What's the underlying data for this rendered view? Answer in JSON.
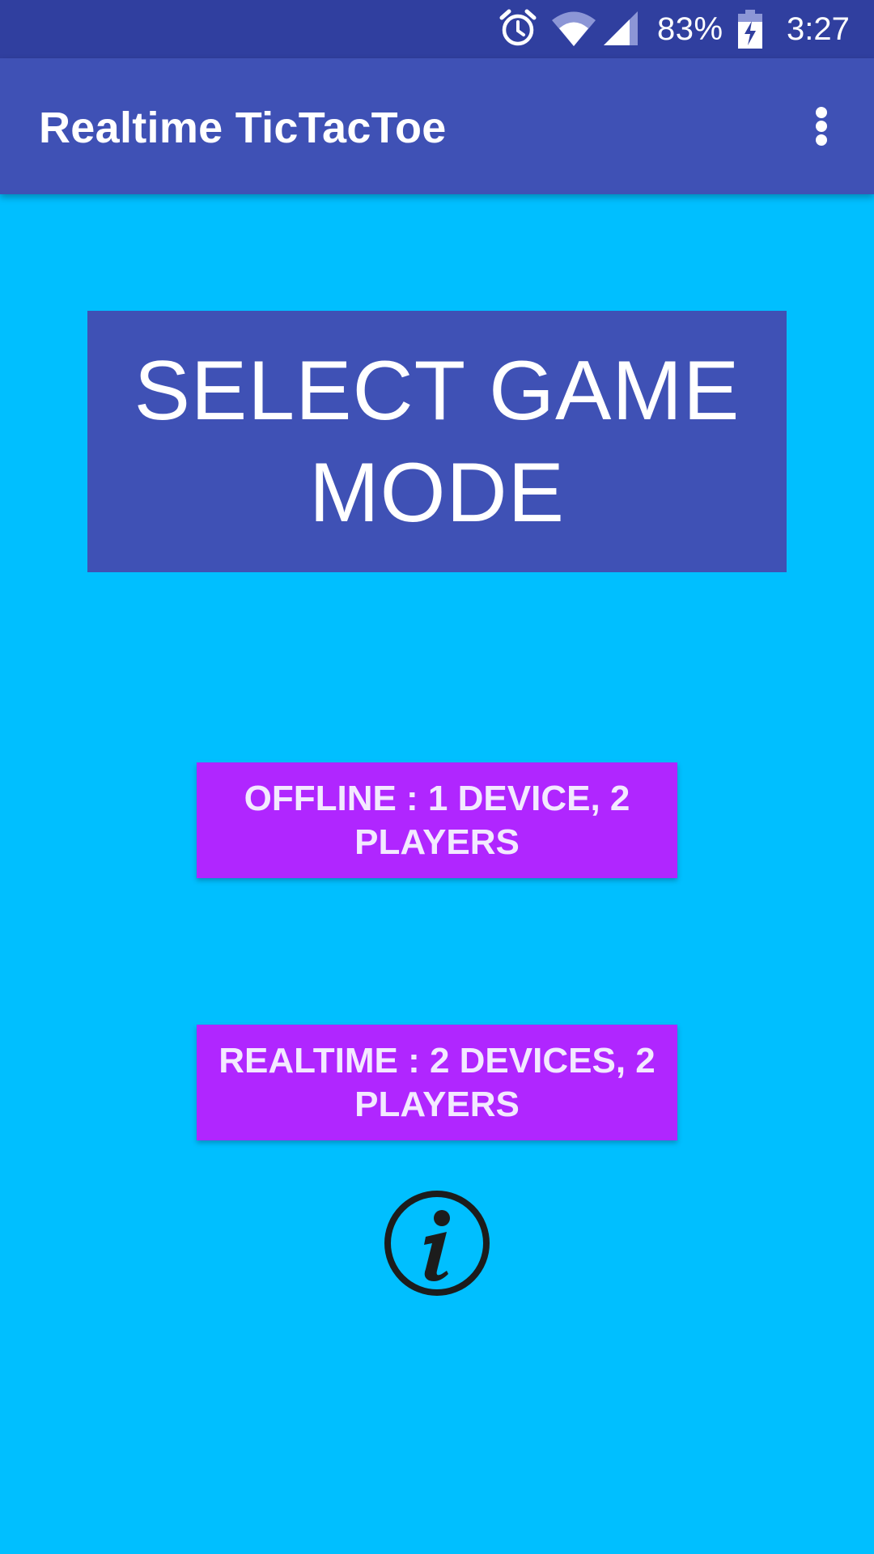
{
  "status_bar": {
    "battery_percent": "83%",
    "time": "3:27",
    "icons": [
      "alarm-icon",
      "wifi-icon",
      "cell-signal-icon",
      "battery-charging-icon"
    ]
  },
  "app_bar": {
    "title": "Realtime TicTacToe",
    "overflow_icon": "more-vert-icon"
  },
  "main": {
    "heading": "SELECT GAME MODE",
    "offline_button": "OFFLINE : 1 DEVICE, 2 PLAYERS",
    "realtime_button": "REALTIME : 2 DEVICES, 2 PLAYERS",
    "info_icon": "info-icon"
  },
  "colors": {
    "background": "#00BFFF",
    "status_bar": "#303F9F",
    "app_bar": "#3F51B5",
    "heading_box": "#3F51B5",
    "button": "#B026FF"
  }
}
